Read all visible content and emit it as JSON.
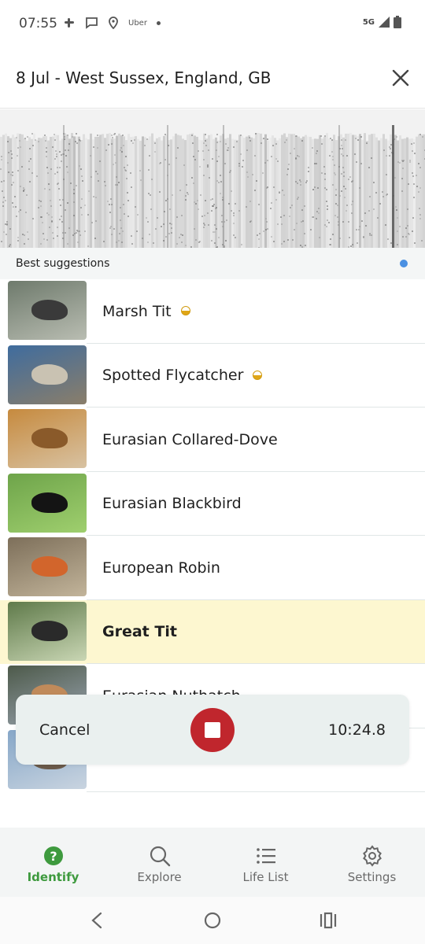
{
  "status": {
    "time": "07:55",
    "uber": "Uber",
    "network": "5G"
  },
  "header": {
    "title": "8 Jul - West Sussex, England, GB",
    "close_icon": "close-icon"
  },
  "suggestions": {
    "label": "Best suggestions"
  },
  "birds": [
    {
      "name": "Marsh Tit",
      "badge": true,
      "highlighted": false
    },
    {
      "name": "Spotted Flycatcher",
      "badge": true,
      "highlighted": false
    },
    {
      "name": "Eurasian Collared-Dove",
      "badge": false,
      "highlighted": false
    },
    {
      "name": "Eurasian Blackbird",
      "badge": false,
      "highlighted": false
    },
    {
      "name": "European Robin",
      "badge": false,
      "highlighted": false
    },
    {
      "name": "Great Tit",
      "badge": false,
      "highlighted": true
    },
    {
      "name": "Eurasian Nuthatch",
      "badge": false,
      "highlighted": false
    },
    {
      "name": "",
      "badge": false,
      "highlighted": false
    }
  ],
  "recording": {
    "cancel": "Cancel",
    "timer": "10:24.8"
  },
  "nav": [
    {
      "label": "Identify",
      "icon": "help-circle-icon",
      "active": true
    },
    {
      "label": "Explore",
      "icon": "search-icon",
      "active": false
    },
    {
      "label": "Life List",
      "icon": "list-icon",
      "active": false
    },
    {
      "label": "Settings",
      "icon": "gear-icon",
      "active": false
    }
  ],
  "colors": {
    "accent": "#3e9a3e",
    "record": "#c0262d",
    "highlight": "#fdf7d0"
  }
}
